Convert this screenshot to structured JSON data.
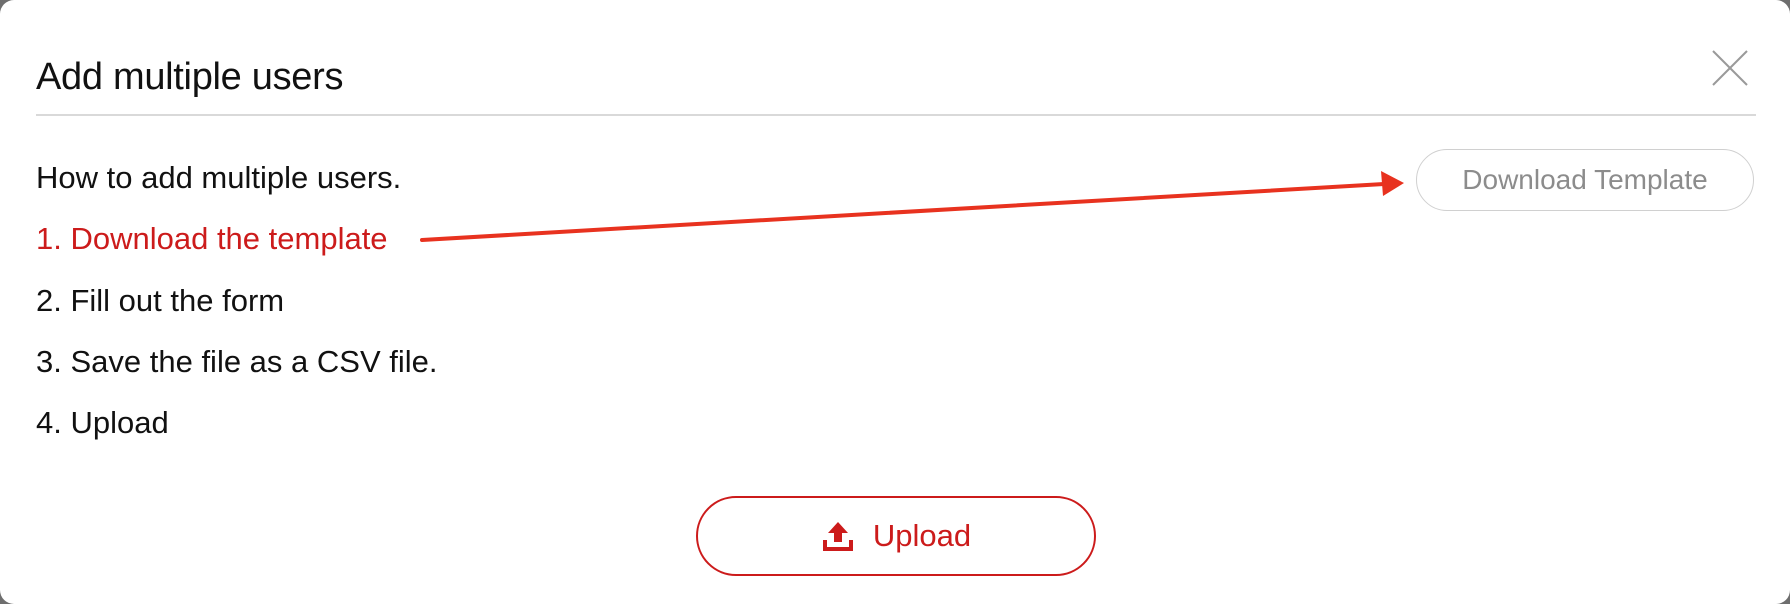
{
  "dialog": {
    "title": "Add multiple users",
    "close_icon": "close-icon"
  },
  "instructions": {
    "intro": "How to add multiple users.",
    "steps": [
      "1. Download the template",
      "2. Fill out the form",
      "3. Save the file as a CSV file.",
      "4. Upload"
    ],
    "highlighted_step_index": 0
  },
  "buttons": {
    "download_template_label": "Download Template",
    "upload_label": "Upload",
    "upload_icon": "upload-icon"
  },
  "annotation": {
    "arrow_color": "#e8321f"
  },
  "colors": {
    "accent_red": "#cc1b1b",
    "title_text": "#111111",
    "secondary_button_text": "#8c8c8c",
    "divider": "#d9d9d9",
    "backdrop": "#6e6e6e"
  }
}
